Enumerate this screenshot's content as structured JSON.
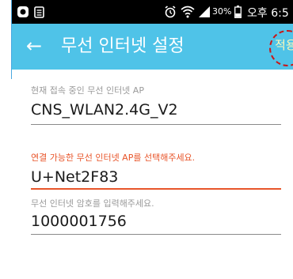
{
  "status_bar": {
    "battery_percent": "30%",
    "time": "오후 6:5"
  },
  "app_bar": {
    "title": "무선 인터넷 설정",
    "action_label": "적용"
  },
  "current_ap": {
    "label": "현재 접속 중인 무선 인터넷 AP",
    "value": "CNS_WLAN2.4G_V2"
  },
  "select_ap": {
    "label": "연결 가능한 무선 인터넷 AP를 선택해주세요.",
    "value": "U+Net2F83"
  },
  "password": {
    "label": "무선 인터넷 암호를 입력해주세요.",
    "value": "1000001756"
  },
  "colors": {
    "app_bar": "#4fc3e8",
    "error_accent": "#e8552a",
    "status_bar": "#000000"
  }
}
